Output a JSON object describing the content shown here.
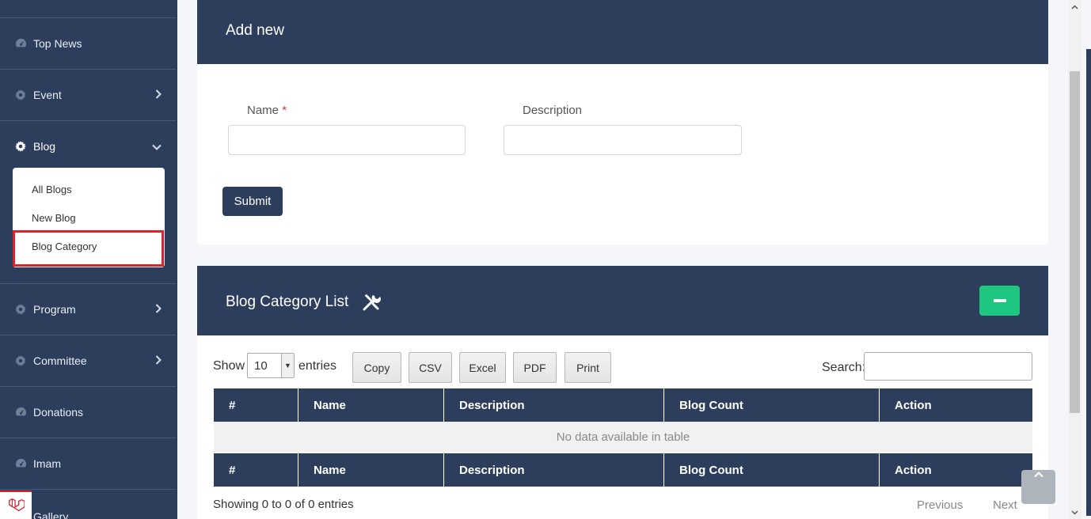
{
  "sidebar": {
    "items": [
      {
        "label": "Top News",
        "icon": "dashboard-icon"
      },
      {
        "label": "Event",
        "icon": "gear-icon"
      },
      {
        "label": "Blog",
        "icon": "gear-icon"
      },
      {
        "label": "Program",
        "icon": "gear-icon"
      },
      {
        "label": "Committee",
        "icon": "gear-icon"
      },
      {
        "label": "Donations",
        "icon": "dashboard-icon"
      },
      {
        "label": "Imam",
        "icon": "dashboard-icon"
      },
      {
        "label": "Gallery",
        "icon": "dashboard-icon"
      }
    ],
    "blog_submenu": [
      {
        "label": "All Blogs"
      },
      {
        "label": "New Blog"
      },
      {
        "label": "Blog Category"
      }
    ]
  },
  "add_form": {
    "title": "Add new",
    "name_label": "Name",
    "required_mark": "*",
    "name_value": "",
    "description_label": "Description",
    "description_value": "",
    "submit_label": "Submit"
  },
  "list": {
    "title": "Blog Category List",
    "show_label": "Show",
    "page_length": "10",
    "entries_label": "entries",
    "buttons": [
      "Copy",
      "CSV",
      "Excel",
      "PDF",
      "Print"
    ],
    "search_label": "Search:",
    "search_value": "",
    "columns": [
      "#",
      "Name",
      "Description",
      "Blog Count",
      "Action"
    ],
    "empty_message": "No data available in table",
    "info": "Showing 0 to 0 of 0 entries",
    "previous_label": "Previous",
    "next_label": "Next"
  },
  "colors": {
    "navy": "#2c3e5c",
    "accent_green": "#1ec77f",
    "highlight_red": "#e0202a"
  }
}
